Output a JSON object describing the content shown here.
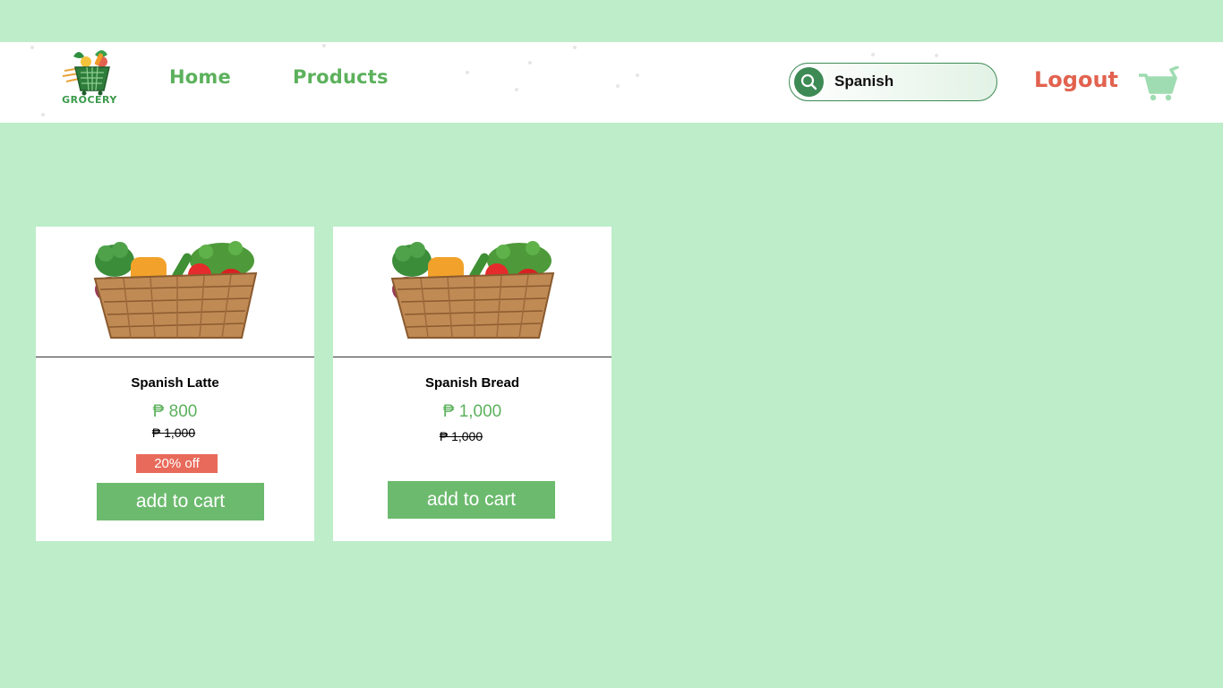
{
  "nav": {
    "logo_text": "GROCERY",
    "home_label": "Home",
    "products_label": "Products",
    "logout_label": "Logout",
    "search": {
      "value": "Spanish"
    },
    "icons": {
      "search": "search-icon",
      "cart": "cart-icon",
      "logo": "grocery-basket-logo"
    }
  },
  "products": [
    {
      "name": "Spanish Latte",
      "price": "₱ 800",
      "old_price": "₱ 1,000",
      "discount": "20% off",
      "button_label": "add to cart"
    },
    {
      "name": "Spanish Bread",
      "price": "₱ 1,000",
      "old_price": "₱ 1,000",
      "button_label": "add to cart"
    }
  ],
  "colors": {
    "page_bg": "#bdedc9",
    "brand_green": "#5cb15c",
    "search_green": "#3d8a55",
    "accent_red": "#e2624f",
    "button_green": "#6cba6e",
    "discount_red": "#e86a5a"
  }
}
